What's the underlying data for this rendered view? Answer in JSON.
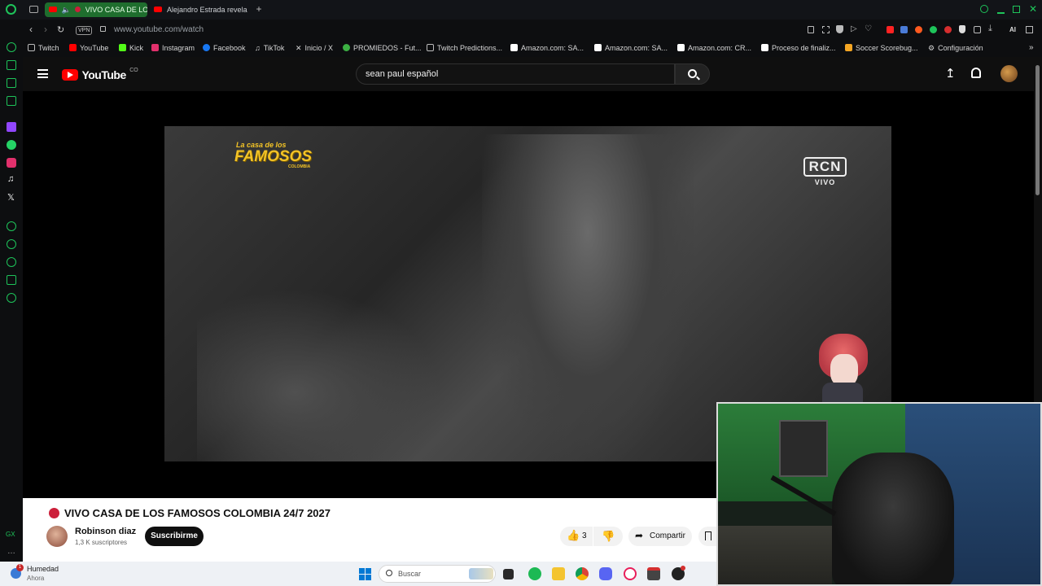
{
  "browser": {
    "tabs": [
      {
        "label": "VIVO CASA DE LOS",
        "active": true
      },
      {
        "label": "Alejandro Estrada revela c",
        "active": false
      }
    ],
    "new_tab_symbol": "+",
    "url": "www.youtube.com/watch",
    "vpn_label": "VPN",
    "ai_label": "AI",
    "bookmarks": [
      {
        "label": "Twitch",
        "color": "#9146ff"
      },
      {
        "label": "YouTube",
        "color": "#ff0000"
      },
      {
        "label": "Kick",
        "color": "#53fc18"
      },
      {
        "label": "Instagram",
        "color": "#e1306c"
      },
      {
        "label": "Facebook",
        "color": "#1877f2"
      },
      {
        "label": "TikTok",
        "color": "#ffffff"
      },
      {
        "label": "Inicio / X",
        "color": "#ffffff"
      },
      {
        "label": "PROMIEDOS - Fut...",
        "color": "#3cb043"
      },
      {
        "label": "Twitch Predictions...",
        "color": "#bbbbbb"
      },
      {
        "label": "Amazon.com: SA...",
        "color": "#ffffff"
      },
      {
        "label": "Amazon.com: SA...",
        "color": "#ffffff"
      },
      {
        "label": "Amazon.com: CR...",
        "color": "#ffffff"
      },
      {
        "label": "Proceso de finaliz...",
        "color": "#ffffff"
      },
      {
        "label": "Soccer Scorebug...",
        "color": "#f5a623"
      },
      {
        "label": "Configuración",
        "color": "#bbbbbb"
      }
    ]
  },
  "youtube": {
    "logo_text": "YouTube",
    "country_code": "CO",
    "search_value": "sean paul español",
    "video_overlay": {
      "show_logo_line1": "La casa de los",
      "show_logo_line2": "FAMOSOS",
      "show_logo_line3": "COLOMBIA",
      "channel_bug": "RCN",
      "live_label": "VIVO"
    },
    "video_title": "VIVO CASA DE LOS FAMOSOS COLOMBIA 24/7 2027",
    "channel_name": "Robinson diaz",
    "subscribers": "1,3 K suscriptores",
    "subscribe_label": "Suscribirme",
    "likes": "3",
    "share_label": "Compartir"
  },
  "taskbar": {
    "weather_title": "Humedad",
    "weather_sub": "Ahora",
    "weather_badge": "1",
    "search_placeholder": "Buscar"
  },
  "colors": {
    "accent_green": "#1ec45a",
    "youtube_red": "#ff0000",
    "live_dot": "#cc1f3a"
  }
}
